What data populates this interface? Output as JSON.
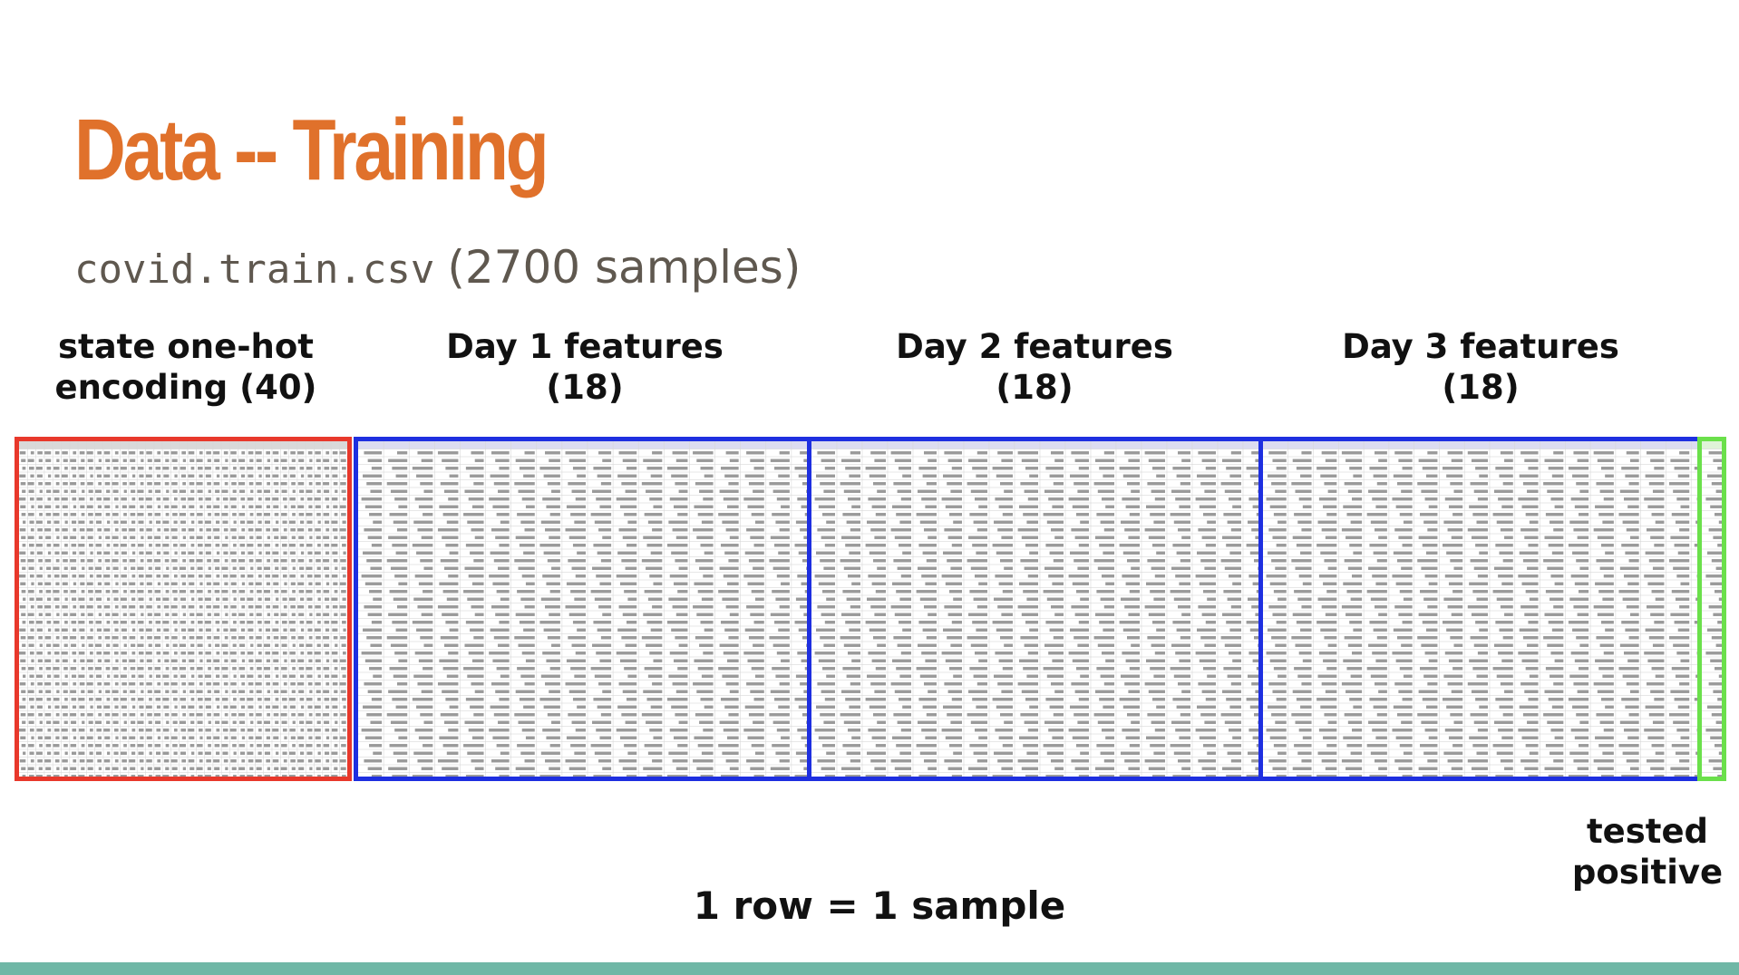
{
  "title": "Data -- Training",
  "subtitle": {
    "filename": "covid.train.csv",
    "sample_count": "(2700 samples)"
  },
  "labels": {
    "state": {
      "line1": "state one-hot",
      "line2": "encoding (40)"
    },
    "day1": {
      "line1": "Day 1 features",
      "line2": "(18)"
    },
    "day2": {
      "line1": "Day 2 features",
      "line2": "(18)"
    },
    "day3": {
      "line1": "Day 3 features",
      "line2": "(18)"
    },
    "target": {
      "line1": "tested",
      "line2": "positive"
    }
  },
  "caption": "1 row = 1 sample",
  "colors": {
    "title": "#E0712B",
    "state_border": "#E8382B",
    "features_border": "#1E2FE0",
    "target_border": "#6BE04B",
    "footer_bar": "#6fb7a6"
  }
}
